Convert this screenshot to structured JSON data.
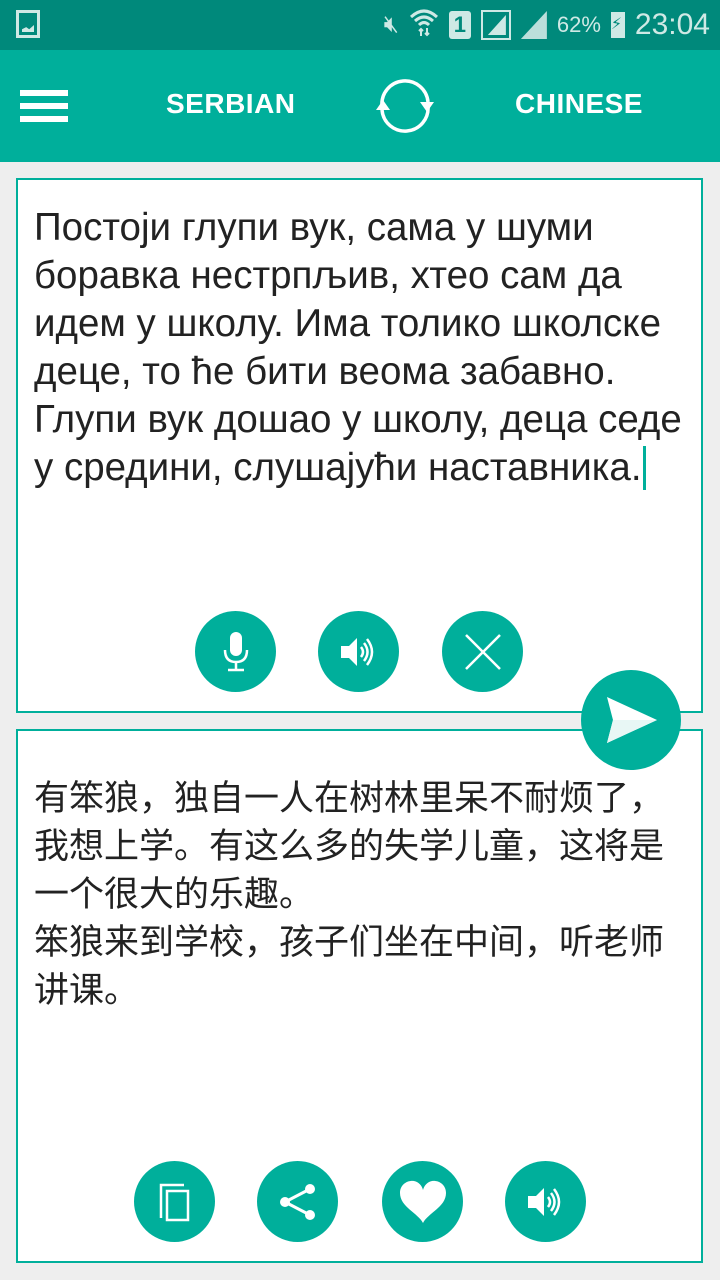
{
  "status_bar": {
    "left_icon": "gallery-icon",
    "icons": [
      "vibrate-mute-icon",
      "wifi-icon",
      "sim-icon",
      "signal-icon",
      "signal-icon-2",
      "battery-charging-icon"
    ],
    "sim_label": "1",
    "battery_percent": "62%",
    "time": "23:04"
  },
  "app_bar": {
    "menu_icon": "hamburger-menu-icon",
    "source_language": "SERBIAN",
    "swap_icon": "swap-arrows-icon",
    "target_language": "CHINESE"
  },
  "source_panel": {
    "text": "Постоји глупи вук, сама у шуми боравка нестрпљив, хтео сам да идем у школу. Има толико школске деце, то ће бити веома забавно.\nГлупи вук дошао у школу, деца седе у средини, слушајући наставника.",
    "actions": [
      {
        "name": "microphone",
        "icon": "microphone-icon"
      },
      {
        "name": "speak-source",
        "icon": "speaker-icon"
      },
      {
        "name": "clear",
        "icon": "close-icon"
      }
    ]
  },
  "translate_button": {
    "icon": "send-icon"
  },
  "target_panel": {
    "text": "有笨狼，独自一人在树林里呆不耐烦了，我想上学。有这么多的失学儿童，这将是一个很大的乐趣。\n笨狼来到学校，孩子们坐在中间，听老师讲课。",
    "actions": [
      {
        "name": "copy",
        "icon": "copy-icon"
      },
      {
        "name": "share",
        "icon": "share-icon"
      },
      {
        "name": "favorite",
        "icon": "heart-icon"
      },
      {
        "name": "speak-target",
        "icon": "speaker-icon"
      }
    ]
  },
  "colors": {
    "status_bar": "#00897b",
    "accent": "#00af9b",
    "background": "#eeeeee",
    "text": "#222222"
  }
}
